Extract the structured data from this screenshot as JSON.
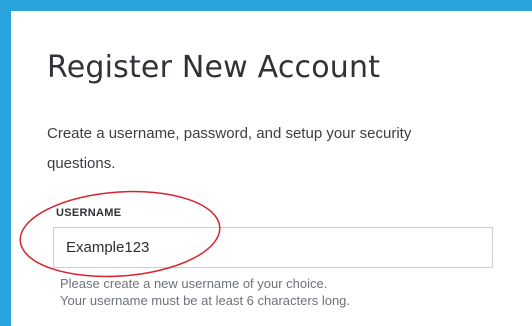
{
  "page": {
    "title": "Register New Account",
    "intro": "Create a username, password, and setup your security questions."
  },
  "username_field": {
    "label": "USERNAME",
    "value": "Example123",
    "help_line_1": "Please create a new username of your choice.",
    "help_line_2": "Your username must be at least 6 characters long."
  },
  "colors": {
    "frame_border": "#2aa3dc",
    "annotation": "#d9232e",
    "input_border": "#c9cfd4",
    "help_text": "#6e7379"
  }
}
